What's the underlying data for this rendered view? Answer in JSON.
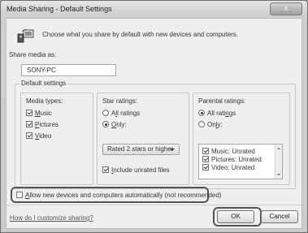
{
  "window": {
    "title": "Media Sharing - Default Settings",
    "close_label": "x"
  },
  "intro": {
    "icon": "media-sharing-icon",
    "text": "Choose what you share by default with new devices and computers."
  },
  "share_media": {
    "label": "Share media as:",
    "value": "SONY-PC"
  },
  "default_settings": {
    "label": "Default settings",
    "media_types": {
      "label": "Media types:",
      "items": [
        {
          "label_initial": "M",
          "label_rest": "usic",
          "checked": true
        },
        {
          "label_initial": "P",
          "label_rest": "ictures",
          "checked": true
        },
        {
          "label_initial": "V",
          "label_rest": "ideo",
          "checked": true
        }
      ]
    },
    "star_ratings": {
      "label": "Star ratings:",
      "all_prefix": "A",
      "all_initial": "l",
      "all_rest": "l ratings",
      "only_initial": "O",
      "only_rest": "nly:",
      "selected": "only",
      "dropdown_value": "Rated 2 stars or higher",
      "include_prefix": "I",
      "include_rest": "nclude unrated files",
      "include_checked": true
    },
    "parental_ratings": {
      "label": "Parental ratings:",
      "all_prefix": "All rati",
      "all_initial": "n",
      "all_rest": "gs",
      "only_initial": "On",
      "only_underline": "l",
      "only_rest": "y:",
      "selected": "all",
      "list": [
        {
          "text": "Music: Unrated",
          "checked": true
        },
        {
          "text": "Pictures: Unrated",
          "checked": true
        },
        {
          "text": "Video: Unrated",
          "checked": true
        }
      ]
    }
  },
  "allow_new": {
    "initial": "A",
    "rest": "llow new devices and computers automatically (not recommended)",
    "checked": false
  },
  "footer": {
    "help_link": "How do I customize sharing?",
    "ok_label": "OK",
    "cancel_label": "Cancel"
  }
}
